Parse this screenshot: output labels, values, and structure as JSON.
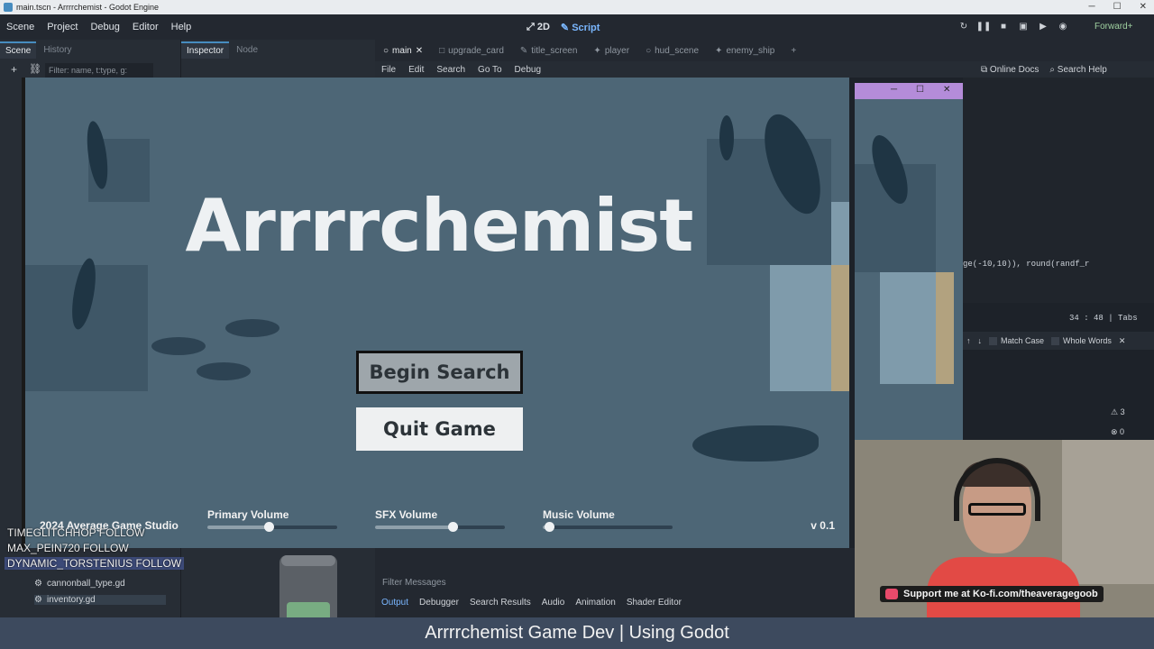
{
  "window": {
    "title": "main.tscn - Arrrrchemist - Godot Engine"
  },
  "menu": [
    "Scene",
    "Project",
    "Debug",
    "Editor",
    "Help"
  ],
  "workspace": {
    "two_d": "2D",
    "script": "Script"
  },
  "renderer": "Forward+",
  "left_dock": {
    "tabs": [
      "Scene",
      "History"
    ],
    "filter_placeholder": "Filter: name, t:type, g:"
  },
  "inspector_dock": {
    "tabs": [
      "Inspector",
      "Node"
    ]
  },
  "editor_tabs": [
    "main",
    "upgrade_card",
    "title_screen",
    "player",
    "hud_scene",
    "enemy_ship"
  ],
  "editor_menu": [
    "File",
    "Edit",
    "Search",
    "Go To",
    "Debug"
  ],
  "help_buttons": {
    "online_docs": "Online Docs",
    "search_help": "Search Help"
  },
  "code": {
    "visible_line": "ge(-10,10)), round(randf_r",
    "cursor": "34 :  48 | Tabs"
  },
  "find": {
    "match_case": "Match Case",
    "whole_words": "Whole Words"
  },
  "counts": {
    "warnings": "3",
    "errors": "0"
  },
  "game": {
    "title": "Arrrrchemist",
    "begin_button": "Begin Search",
    "quit_button": "Quit Game",
    "studio": "2024 Average Game Studio",
    "version": "v 0.1",
    "volumes": [
      {
        "label": "Primary Volume",
        "level": 0.47
      },
      {
        "label": "SFX Volume",
        "level": 0.6
      },
      {
        "label": "Music Volume",
        "level": 0.05
      }
    ]
  },
  "files": [
    "cannonball_type.gd",
    "inventory.gd"
  ],
  "chat": [
    {
      "text": "TIMEGLITCHHOP FOLLOW"
    },
    {
      "text": "MAX_PEIN720  FOLLOW"
    },
    {
      "text": "DYNAMIC_TORSTENIUS  FOLLOW"
    }
  ],
  "bottom_panel": {
    "filter": "Filter Messages",
    "tabs": [
      "Output",
      "Debugger",
      "Search Results",
      "Audio",
      "Animation",
      "Shader Editor"
    ]
  },
  "kofi": "Support me at Ko-fi.com/theaveragegoob",
  "caption": "Arrrrchemist Game Dev | Using Godot"
}
